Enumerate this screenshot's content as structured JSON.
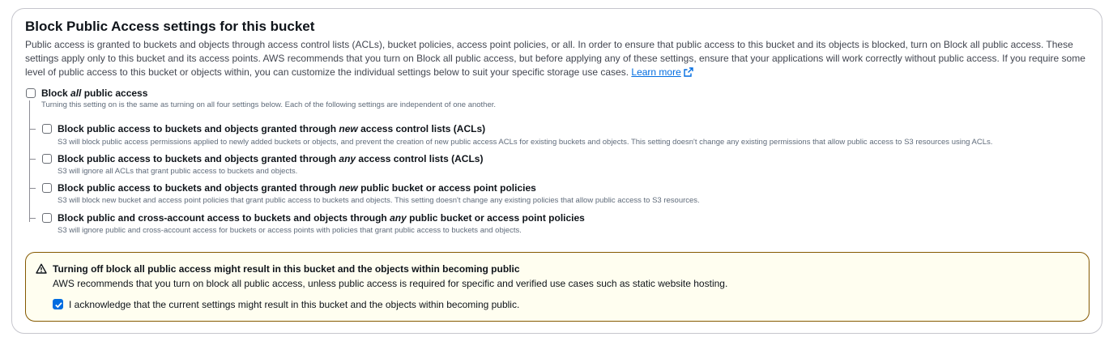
{
  "section": {
    "title": "Block Public Access settings for this bucket",
    "description": "Public access is granted to buckets and objects through access control lists (ACLs), bucket policies, access point policies, or all. In order to ensure that public access to this bucket and its objects is blocked, turn on Block all public access. These settings apply only to this bucket and its access points. AWS recommends that you turn on Block all public access, but before applying any of these settings, ensure that your applications will work correctly without public access. If you require some level of public access to this bucket or objects within, you can customize the individual settings below to suit your specific storage use cases.",
    "learn_more": "Learn more"
  },
  "block_all": {
    "label_pre": "Block ",
    "label_em": "all",
    "label_post": " public access",
    "description": "Turning this setting on is the same as turning on all four settings below. Each of the following settings are independent of one another.",
    "checked": false
  },
  "options": [
    {
      "label_pre": "Block public access to buckets and objects granted through ",
      "label_em": "new",
      "label_post": " access control lists (ACLs)",
      "description": "S3 will block public access permissions applied to newly added buckets or objects, and prevent the creation of new public access ACLs for existing buckets and objects. This setting doesn't change any existing permissions that allow public access to S3 resources using ACLs.",
      "checked": false
    },
    {
      "label_pre": "Block public access to buckets and objects granted through ",
      "label_em": "any",
      "label_post": " access control lists (ACLs)",
      "description": "S3 will ignore all ACLs that grant public access to buckets and objects.",
      "checked": false
    },
    {
      "label_pre": "Block public access to buckets and objects granted through ",
      "label_em": "new",
      "label_post": " public bucket or access point policies",
      "description": "S3 will block new bucket and access point policies that grant public access to buckets and objects. This setting doesn't change any existing policies that allow public access to S3 resources.",
      "checked": false
    },
    {
      "label_pre": "Block public and cross-account access to buckets and objects through ",
      "label_em": "any",
      "label_post": " public bucket or access point policies",
      "description": "S3 will ignore public and cross-account access for buckets or access points with policies that grant public access to buckets and objects.",
      "checked": false
    }
  ],
  "warning": {
    "icon": "warning-triangle-icon",
    "title": "Turning off block all public access might result in this bucket and the objects within becoming public",
    "text": "AWS recommends that you turn on block all public access, unless public access is required for specific and verified use cases such as static website hosting.",
    "acknowledge_label": "I acknowledge that the current settings might result in this bucket and the objects within becoming public.",
    "acknowledge_checked": true,
    "border_color": "#855900",
    "background_color": "#fffef0"
  },
  "colors": {
    "link": "#006ce0",
    "checkbox_checked": "#006ce0"
  }
}
